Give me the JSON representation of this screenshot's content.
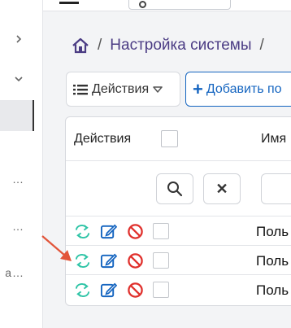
{
  "sidebar": {
    "items": [
      {
        "icon": "chevron-right-icon"
      },
      {
        "icon": "chevron-down-icon"
      },
      {
        "truncated": "…"
      },
      {
        "truncated": "…"
      },
      {
        "truncated": "а…"
      }
    ]
  },
  "header": {
    "menu_icon": "hamburger-menu-icon",
    "search_icon": "search-icon"
  },
  "breadcrumb": {
    "home_icon": "home-icon",
    "separator": "/",
    "current": "Настройка системы",
    "trailing_separator": "/"
  },
  "toolbar": {
    "actions_label": "Действия",
    "actions_icon": "list-icon",
    "actions_caret": "caret-down-icon",
    "add_label": "Добавить по",
    "add_symbol": "+"
  },
  "table": {
    "columns": {
      "actions": "Действия",
      "name": "Имя"
    },
    "filter": {
      "clear_symbol": "✕"
    },
    "rows": [
      {
        "name": "Поль"
      },
      {
        "name": "Поль"
      },
      {
        "name": "Поль"
      }
    ]
  },
  "colors": {
    "accent_blue": "#1565c0",
    "sync_green": "#2ec4a6",
    "block_red": "#e0302c",
    "breadcrumb_purple": "#4b3c84",
    "annotation_arrow": "#e2553a"
  }
}
